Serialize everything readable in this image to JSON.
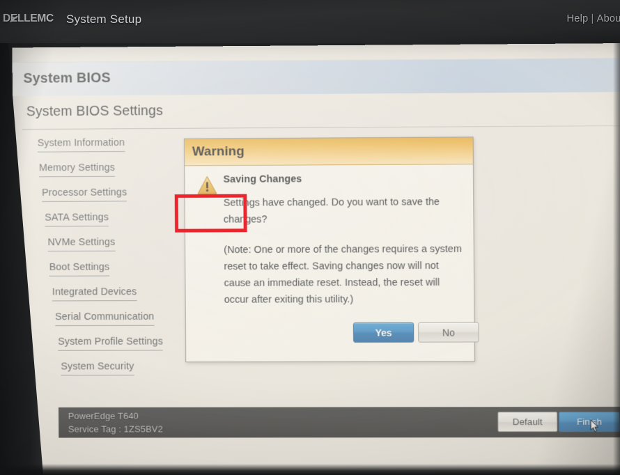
{
  "topbar": {
    "logo_dell": "D",
    "logo_ell": "LL",
    "logo_emc": "EMC",
    "title": "System Setup",
    "help_label": "Help",
    "separator": "|",
    "about_label": "About"
  },
  "header": {
    "bios_bar_title": "System BIOS",
    "settings_title": "System BIOS Settings"
  },
  "sidebar": {
    "items": [
      {
        "label": "System Information"
      },
      {
        "label": "Memory Settings"
      },
      {
        "label": "Processor Settings"
      },
      {
        "label": "SATA Settings"
      },
      {
        "label": "NVMe Settings"
      },
      {
        "label": "Boot Settings"
      },
      {
        "label": "Integrated Devices"
      },
      {
        "label": "Serial Communication"
      },
      {
        "label": "System Profile Settings"
      },
      {
        "label": "System Security"
      }
    ]
  },
  "dialog": {
    "title": "Warning",
    "icon": "warning-triangle-icon",
    "heading": "Saving Changes",
    "paragraph_1": "Settings have changed. Do you want to save the changes?",
    "paragraph_2": "(Note: One or more of the changes requires a system reset to take effect. Saving changes now will not cause an immediate reset. Instead, the reset will occur after exiting this utility.)",
    "yes_label": "Yes",
    "no_label": "No",
    "highlight_color": "#ec1c24",
    "title_bar_color": "#edb64b",
    "primary_button_color": "#2d84c4"
  },
  "footer": {
    "model": "PowerEdge T640",
    "service_tag": "Service Tag : 1ZS5BV2",
    "default_label": "Default",
    "finish_label": "Finish",
    "cursor": "mouse-pointer-icon"
  }
}
